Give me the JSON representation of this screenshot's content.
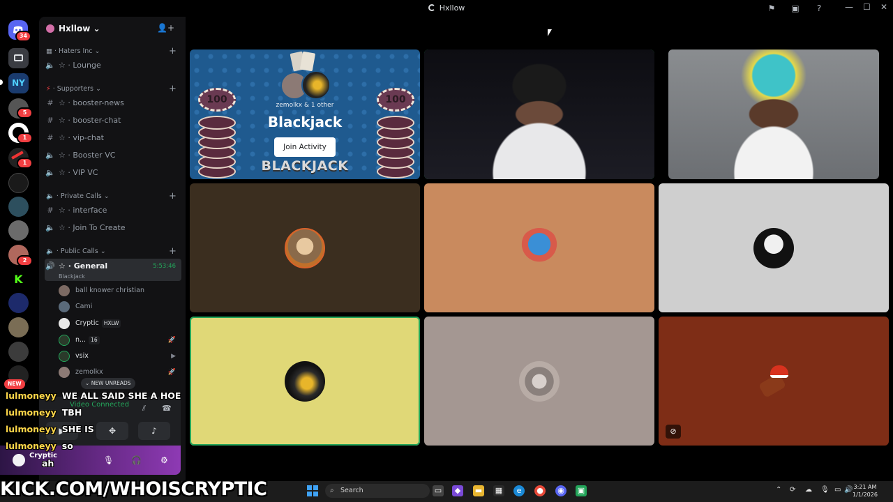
{
  "window": {
    "title": "Hxllow"
  },
  "rail": {
    "home_badge": "34",
    "badges": [
      "5",
      "1",
      "1",
      "2"
    ],
    "new_label": "NEW"
  },
  "server": {
    "name": "Hxllow"
  },
  "categories": [
    {
      "name": "Haters Inc"
    },
    {
      "name": "Supporters"
    },
    {
      "name": "Private Calls"
    },
    {
      "name": "Public Calls"
    }
  ],
  "channels": {
    "lounge": "Lounge",
    "booster_news": "booster-news",
    "booster_chat": "booster-chat",
    "vip_chat": "vip-chat",
    "booster_vc": "Booster VC",
    "vip_vc": "VIP VC",
    "interface": "interface",
    "join_to_create": "Join To Create",
    "general": "General",
    "general_timer": "5:53:46",
    "general_activity": "Blackjack"
  },
  "members": [
    {
      "name": "ball knower christian",
      "tag": "",
      "extra": ""
    },
    {
      "name": "Cami",
      "tag": "",
      "extra": ""
    },
    {
      "name": "Cryptic",
      "tag": "HXLW",
      "extra": ""
    },
    {
      "name": "n...",
      "tag": "16",
      "extra": ""
    },
    {
      "name": "vsix",
      "tag": "",
      "extra": ""
    },
    {
      "name": "zemolkx",
      "tag": "",
      "extra": ""
    }
  ],
  "new_unreads": "NEW UNREADS",
  "voice_panel": {
    "status": "Video Connected"
  },
  "user_panel": {
    "name": "Cryptic"
  },
  "chat_overlay": [
    {
      "user": "lulmoneyy",
      "text": "WE ALL SAID SHE A HOE"
    },
    {
      "user": "lulmoneyy",
      "text": "TBH"
    },
    {
      "user": "lulmoneyy",
      "text": "SHE IS"
    },
    {
      "user": "lulmoneyy",
      "text": "so"
    },
    {
      "user": "",
      "text": "ah"
    }
  ],
  "activity": {
    "participants": "zemolkx & 1 other",
    "title": "Blackjack",
    "join_label": "Join Activity",
    "chip_value": "100",
    "logo_text": "BLACKJACK"
  },
  "tiles": {
    "colors": [
      "#3b2e1f",
      "#c98a5e",
      "#cfcfcf",
      "#e0d877",
      "#a49792",
      "#7e2d16"
    ]
  },
  "banner": {
    "text": "KICK.COM/WHOISCRYPTIC"
  },
  "taskbar": {
    "search_placeholder": "Search",
    "time": "3:21 AM",
    "date": "1/1/2026"
  }
}
